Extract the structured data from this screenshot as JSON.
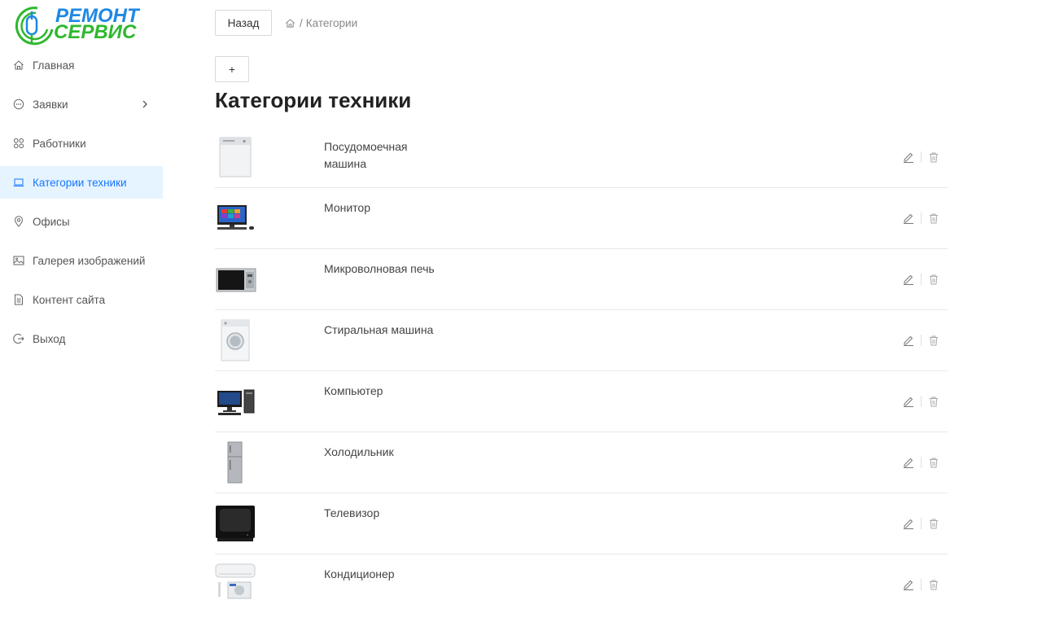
{
  "logo": {
    "line1": "РЕМОНТ",
    "line2": "СЕРВИС"
  },
  "nav": [
    {
      "label": "Главная",
      "icon": "home-icon"
    },
    {
      "label": "Заявки",
      "icon": "chat-icon",
      "has_arrow": true
    },
    {
      "label": "Работники",
      "icon": "team-icon"
    },
    {
      "label": "Категории техники",
      "icon": "laptop-icon",
      "active": true
    },
    {
      "label": "Офисы",
      "icon": "location-icon"
    },
    {
      "label": "Галерея изображений",
      "icon": "image-icon"
    },
    {
      "label": "Контент сайта",
      "icon": "file-icon"
    },
    {
      "label": "Выход",
      "icon": "logout-icon"
    }
  ],
  "toolbar": {
    "back_label": "Назад",
    "add_label": "+"
  },
  "breadcrumb": {
    "sep": "/",
    "current": "Категории"
  },
  "page": {
    "title": "Категории техники"
  },
  "categories": [
    {
      "name": "Посудомоечная машина",
      "image": "dishwasher"
    },
    {
      "name": "Монитор",
      "image": "monitor"
    },
    {
      "name": "Микроволновая печь",
      "image": "microwave"
    },
    {
      "name": "Стиральная машина",
      "image": "washer"
    },
    {
      "name": "Компьютер",
      "image": "computer"
    },
    {
      "name": "Холодильник",
      "image": "fridge"
    },
    {
      "name": "Телевизор",
      "image": "tv"
    },
    {
      "name": "Кондиционер",
      "image": "aircon"
    }
  ],
  "colors": {
    "accent": "#1677ff",
    "active_bg": "#e6f4ff",
    "logo_blue": "#1e88e5",
    "logo_green": "#2eb82e"
  }
}
